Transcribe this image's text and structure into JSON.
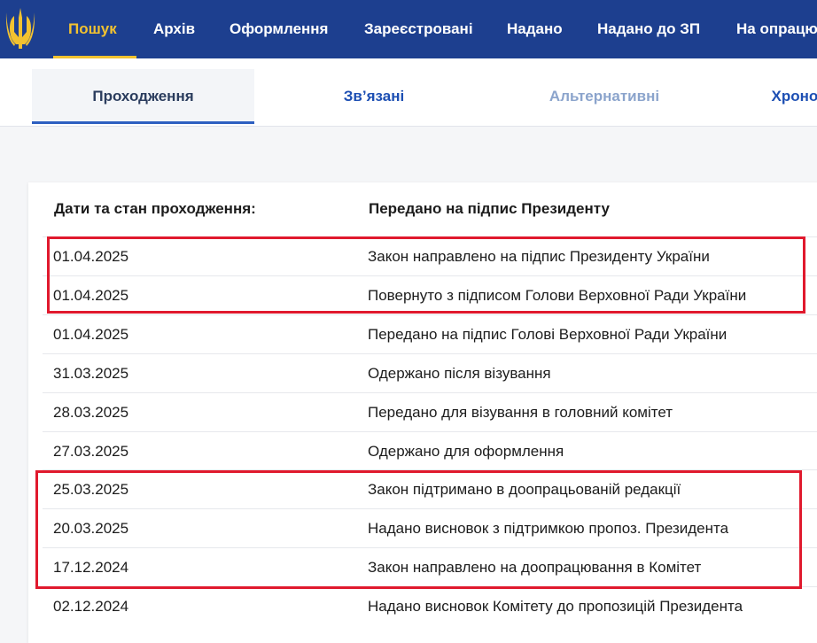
{
  "nav": {
    "items": [
      "Пошук",
      "Архів",
      "Оформлення",
      "Зареєстровані",
      "Надано",
      "Надано до ЗП",
      "На опрацюванні"
    ],
    "active_color": "#f2c230",
    "background": "#1d3f8f"
  },
  "tabs": [
    "Проходження",
    "Зв’язані",
    "Альтернативні",
    "Хронологія"
  ],
  "table": {
    "header_left": "Дати та стан проходження:",
    "header_right": "Передано на підпис Президенту",
    "rows": [
      {
        "date": "01.04.2025",
        "status": "Закон направлено на підпис Президенту України"
      },
      {
        "date": "01.04.2025",
        "status": "Повернуто з підписом Голови Верховної Ради України"
      },
      {
        "date": "01.04.2025",
        "status": "Передано на підпис Голові Верховної Ради України"
      },
      {
        "date": "31.03.2025",
        "status": "Одержано після візування"
      },
      {
        "date": "28.03.2025",
        "status": "Передано для візування в головний комітет"
      },
      {
        "date": "27.03.2025",
        "status": "Одержано для оформлення"
      },
      {
        "date": "25.03.2025",
        "status": "Закон підтримано в доопрацьованій редакції"
      },
      {
        "date": "20.03.2025",
        "status": "Надано висновок з підтримкою пропоз. Президента"
      },
      {
        "date": "17.12.2024",
        "status": "Закон направлено на доопрацювання в Комітет"
      },
      {
        "date": "02.12.2024",
        "status": "Надано висновок Комітету до пропозицій Президента"
      }
    ]
  },
  "highlight_color": "#e0192d"
}
